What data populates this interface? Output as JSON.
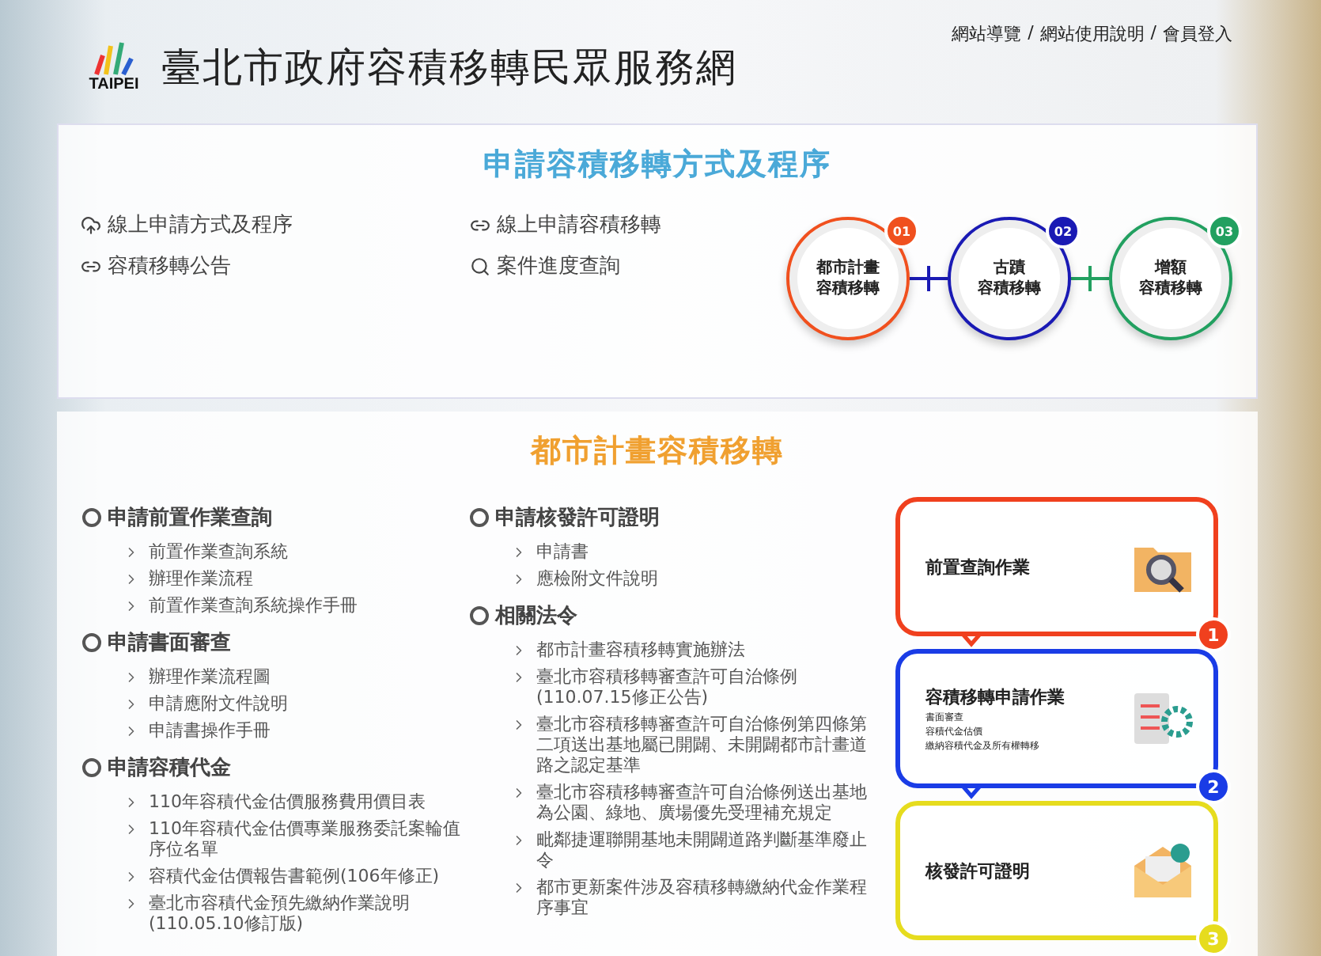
{
  "header": {
    "logo_text": "TAIPEI",
    "site_title": "臺北市政府容積移轉民眾服務網",
    "top_links": [
      "網站導覽",
      "網站使用說明",
      "會員登入"
    ],
    "link_separator": "/"
  },
  "methods": {
    "title": "申請容積移轉方式及程序",
    "links": [
      {
        "kind": "cloud",
        "label": "線上申請方式及程序"
      },
      {
        "kind": "link",
        "label": "線上申請容積移轉"
      },
      {
        "kind": "link",
        "label": "容積移轉公告"
      },
      {
        "kind": "search",
        "label": "案件進度查詢"
      }
    ],
    "steps": [
      {
        "number": "01",
        "lines": [
          "都市計畫",
          "容積移轉"
        ],
        "color": "#f0501e"
      },
      {
        "number": "02",
        "lines": [
          "古蹟",
          "容積移轉"
        ],
        "color": "#1a1ab4"
      },
      {
        "number": "03",
        "lines": [
          "增額",
          "容積移轉"
        ],
        "color": "#22a060"
      }
    ]
  },
  "urban": {
    "title": "都市計畫容積移轉",
    "columns": [
      [
        {
          "title": "申請前置作業查詢",
          "items": [
            "前置作業查詢系統",
            "辦理作業流程",
            "前置作業查詢系統操作手冊"
          ]
        },
        {
          "title": "申請書面審查",
          "items": [
            "辦理作業流程圖",
            "申請應附文件說明",
            "申請書操作手冊"
          ]
        },
        {
          "title": "申請容積代金",
          "items": [
            "110年容積代金估價服務費用價目表",
            "110年容積代金估價專業服務委託案輪值序位名單",
            "容積代金估價報告書範例(106年修正)",
            "臺北市容積代金預先繳納作業說明(110.05.10修訂版)"
          ]
        }
      ],
      [
        {
          "title": "申請核發許可證明",
          "items": [
            "申請書",
            "應檢附文件說明"
          ]
        },
        {
          "title": "相關法令",
          "items": [
            "都市計畫容積移轉實施辦法",
            "臺北市容積移轉審查許可自治條例(110.07.15修正公告)",
            "臺北市容積移轉審查許可自治條例第四條第二項送出基地屬已開闢、未開闢都市計畫道路之認定基準",
            "臺北市容積移轉審查許可自治條例送出基地為公園、綠地、廣場優先受理補充規定",
            "毗鄰捷運聯開基地未開闢道路判斷基準廢止令",
            "都市更新案件涉及容積移轉繳納代金作業程序事宜"
          ]
        }
      ]
    ],
    "flow": [
      {
        "number": "1",
        "kind": "folder",
        "title": "前置查詢作業",
        "color": "#f0401e"
      },
      {
        "number": "2",
        "kind": "checklist",
        "title": "容積移轉申請作業",
        "lines": [
          "書面審查",
          "容積代金估價",
          "繳納容積代金及所有權轉移"
        ],
        "color": "#1a3ce6"
      },
      {
        "number": "3",
        "kind": "mail",
        "title": "核發許可證明",
        "color": "#e6dc1e"
      }
    ]
  }
}
